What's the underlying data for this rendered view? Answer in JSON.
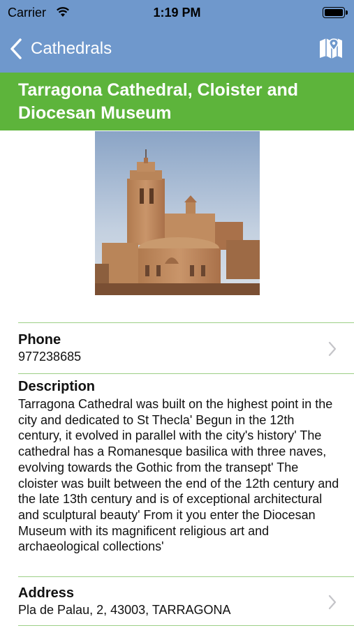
{
  "status": {
    "carrier": "Carrier",
    "time": "1:19 PM"
  },
  "nav": {
    "back_label": "Cathedrals",
    "map_icon": "map-pin-icon"
  },
  "title": "Tarragona Cathedral, Cloister and Diocesan Museum",
  "colors": {
    "header": "#6f98cc",
    "title_bar": "#5db43b",
    "divider": "#9ccf86"
  },
  "phone": {
    "label": "Phone",
    "value": "977238685"
  },
  "description": {
    "label": "Description",
    "text": "Tarragona Cathedral was built on the highest point in the city and dedicated to St Thecla' Begun in the 12th century, it evolved in parallel with the city's history' The cathedral has a Romanesque basilica with three naves, evolving towards the Gothic from the transept' The cloister was built between the end of the 12th century and the late 13th century and is of exceptional architectural and sculptural beauty' From it you enter the Diocesan Museum with its magnificent religious art and archaeological collections'"
  },
  "address": {
    "label": "Address",
    "value": "Pla de Palau, 2, 43003, TARRAGONA"
  }
}
